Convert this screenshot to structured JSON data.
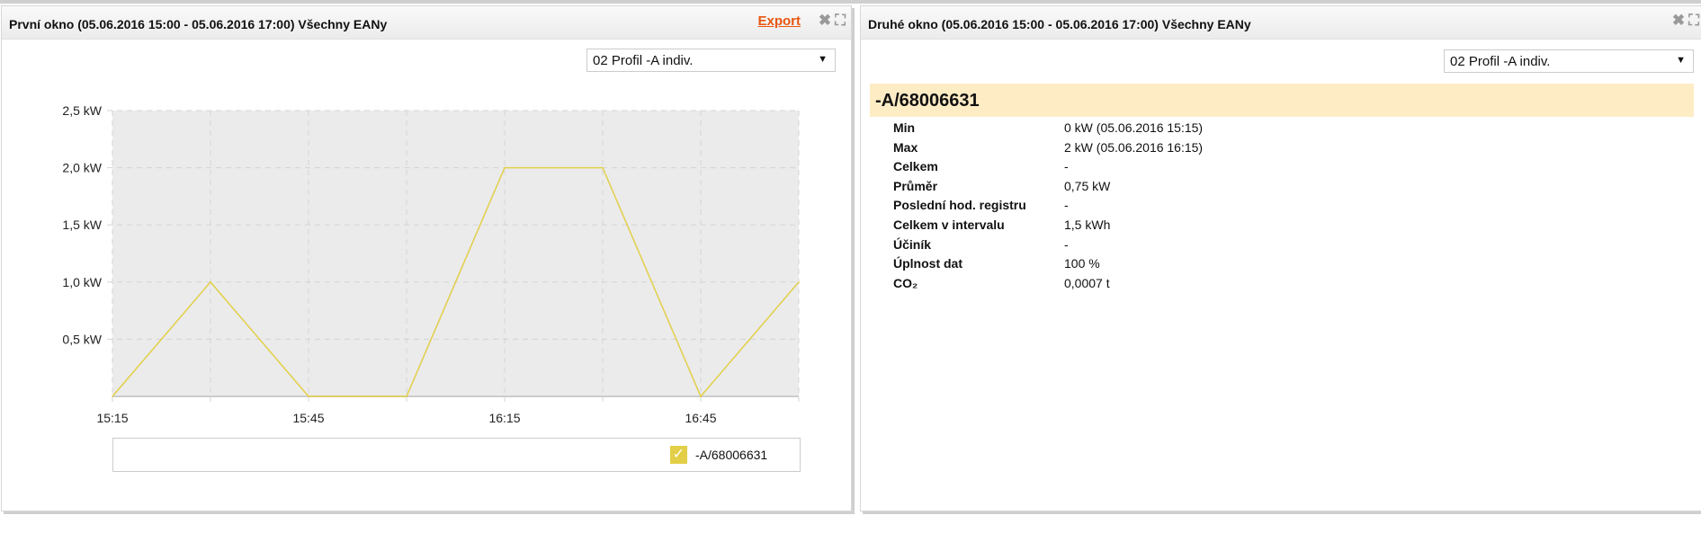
{
  "panel1": {
    "title": "První okno (05.06.2016 15:00 - 05.06.2016 17:00) Všechny EANy",
    "export_label": "Export",
    "profile_select": "02 Profil -A indiv.",
    "legend_label": "-A/68006631"
  },
  "panel2": {
    "title": "Druhé okno (05.06.2016 15:00 - 05.06.2016 17:00) Všechny EANy",
    "profile_select": "02 Profil -A indiv.",
    "ean": "-A/68006631",
    "stats": [
      {
        "label": "Min",
        "value": "0 kW (05.06.2016 15:15)"
      },
      {
        "label": "Max",
        "value": "2 kW (05.06.2016 16:15)"
      },
      {
        "label": "Celkem",
        "value": "-"
      },
      {
        "label": "Průměr",
        "value": "0,75 kW"
      },
      {
        "label": "Poslední hod. registru",
        "value": "-"
      },
      {
        "label": "Celkem v intervalu",
        "value": "1,5 kWh"
      },
      {
        "label": "Účiník",
        "value": "-"
      },
      {
        "label": "Úplnost dat",
        "value": "100 %"
      },
      {
        "label": "CO₂",
        "value": "0,0007 t"
      }
    ]
  },
  "chart_data": {
    "type": "line",
    "x": [
      "15:15",
      "15:30",
      "15:45",
      "16:00",
      "16:15",
      "16:30",
      "16:45",
      "17:00"
    ],
    "series": [
      {
        "name": "-A/68006631",
        "values": [
          0,
          1,
          0,
          0,
          2,
          2,
          0,
          1
        ],
        "color": "#e2cf47"
      }
    ],
    "yticks": [
      "0,5 kW",
      "1,0 kW",
      "1,5 kW",
      "2,0 kW",
      "2,5 kW"
    ],
    "ytick_values": [
      0.5,
      1,
      1.5,
      2,
      2.5
    ],
    "xticks": [
      "15:15",
      "15:45",
      "16:15",
      "16:45"
    ],
    "ylim": [
      0,
      2.5
    ],
    "grid": true,
    "legend": "bottom-right"
  }
}
